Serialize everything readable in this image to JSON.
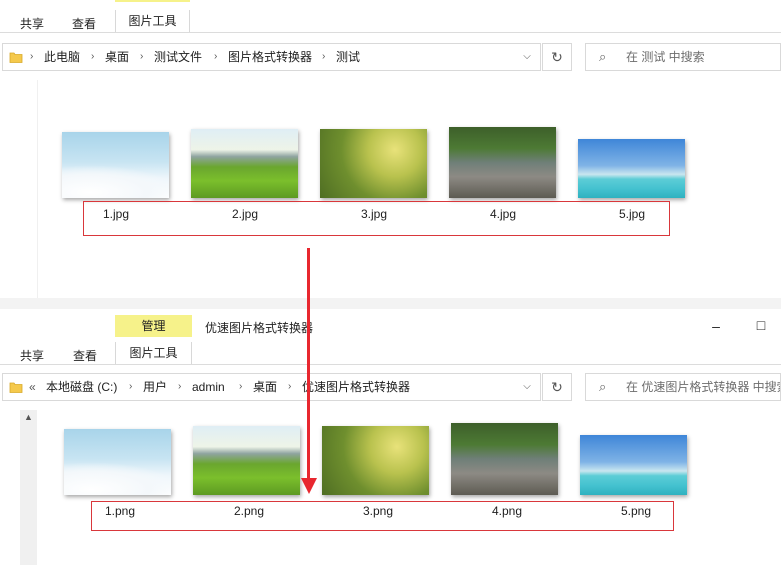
{
  "top": {
    "tabs": [
      "共享",
      "查看"
    ],
    "context_tab": "图片工具",
    "breadcrumb": [
      "此电脑",
      "桌面",
      "测试文件",
      "图片格式转换器",
      "测试"
    ],
    "search_placeholder": "在 测试 中搜索",
    "files": [
      "1.jpg",
      "2.jpg",
      "3.jpg",
      "4.jpg",
      "5.jpg"
    ]
  },
  "bottom": {
    "context_label": "管理",
    "title": "优速图片格式转换器",
    "tabs": [
      "共享",
      "查看"
    ],
    "context_tab": "图片工具",
    "breadcrumb_prefix": "«",
    "breadcrumb": [
      "本地磁盘 (C:)",
      "用户",
      "admin",
      "桌面",
      "优速图片格式转换器"
    ],
    "search_placeholder": "在 优速图片格式转换器 中搜索",
    "files": [
      "1.png",
      "2.png",
      "3.png",
      "4.png",
      "5.png"
    ]
  },
  "icons": {
    "folder": "folder-icon",
    "chevron": "chevron-right-icon",
    "dropdown": "chevron-down-icon",
    "refresh": "refresh-icon",
    "search": "search-icon",
    "minimize": "minimize-icon",
    "maximize": "maximize-icon",
    "arrow": "arrow-down-icon"
  },
  "colors": {
    "highlight_box": "#d9373b",
    "arrow": "#e8272f",
    "context_tab": "#f6f28a"
  }
}
